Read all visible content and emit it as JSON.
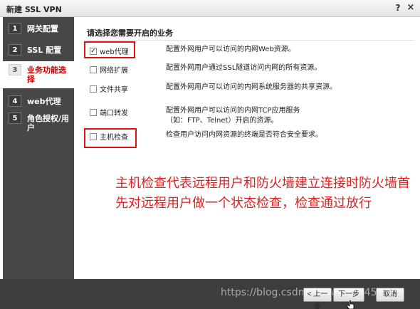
{
  "window": {
    "title": "新建 SSL VPN",
    "help_glyph": "?",
    "close_glyph": "×"
  },
  "sidebar": {
    "steps": [
      {
        "num": "1",
        "label": "网关配置"
      },
      {
        "num": "2",
        "label": "SSL 配置"
      },
      {
        "num": "3",
        "label": "业务功能选择"
      },
      {
        "num": "4",
        "label": "web代理"
      },
      {
        "num": "5",
        "label": "角色授权/用户"
      }
    ]
  },
  "main": {
    "heading": "请选择您需要开启的业务",
    "options": [
      {
        "label": "web代理",
        "checked": true,
        "check_glyph": "✓",
        "desc": "配置外网用户可以访问的内网Web资源。"
      },
      {
        "label": "网络扩展",
        "checked": false,
        "desc": "配置外网用户通过SSL隧道访问内网的所有资源。"
      },
      {
        "label": "文件共享",
        "checked": false,
        "desc": "配置外网用户可以访问的内网系统服务器的共享资源。"
      },
      {
        "label": "端口转发",
        "checked": false,
        "desc_line1": "配置外网用户可以访问的内网TCP应用服务",
        "desc_line2": "（如：FTP、Telnet）开启的资源。"
      },
      {
        "label": "主机检查",
        "checked": false,
        "desc": "检查用户访问内网资源的终端是否符合安全要求。"
      }
    ],
    "annotation": "主机检查代表远程用户和防火墙建立连接时防火墙首先对远程用户做一个状态检查，检查通过放行"
  },
  "footer": {
    "prev_label": "< 上一步",
    "next_label": "下一步",
    "cancel_label": "取消",
    "watermark": "https://blog.csdn.net/weixin_45155"
  },
  "colors": {
    "sidebar_bg": "#474747",
    "footer_bg": "#3d3d3d",
    "active_step": "#cc0000",
    "annotation": "#e02020",
    "highlight_box": "#e01010"
  },
  "icons": {
    "cursor": "hand-pointer-icon"
  }
}
